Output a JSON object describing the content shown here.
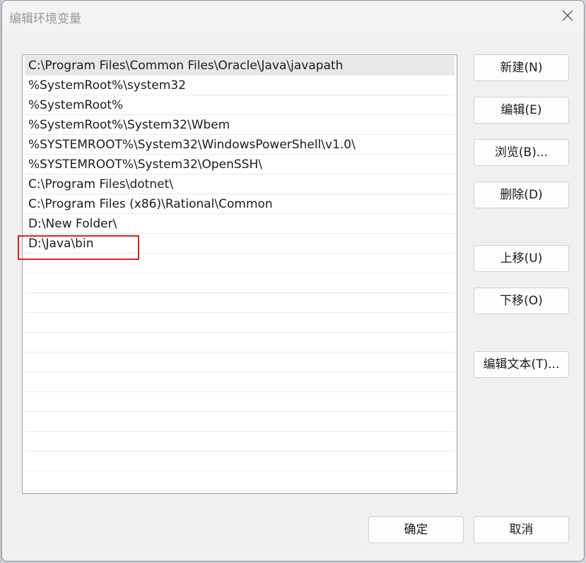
{
  "window": {
    "title": "编辑环境变量"
  },
  "path_list": {
    "items": [
      "C:\\Program Files\\Common Files\\Oracle\\Java\\javapath",
      "%SystemRoot%\\system32",
      "%SystemRoot%",
      "%SystemRoot%\\System32\\Wbem",
      "%SYSTEMROOT%\\System32\\WindowsPowerShell\\v1.0\\",
      "%SYSTEMROOT%\\System32\\OpenSSH\\",
      "C:\\Program Files\\dotnet\\",
      "C:\\Program Files (x86)\\Rational\\Common",
      "D:\\New Folder\\",
      "D:\\Java\\bin"
    ],
    "selected_index": 0,
    "highlighted_index": 9
  },
  "buttons": {
    "new": "新建(N)",
    "edit": "编辑(E)",
    "browse": "浏览(B)...",
    "delete": "删除(D)",
    "move_up": "上移(U)",
    "move_down": "下移(O)",
    "edit_text": "编辑文本(T)...",
    "ok": "确定",
    "cancel": "取消"
  },
  "colors": {
    "highlight_border": "#e02020",
    "selected_row": "#e8e8e8"
  },
  "icons": {
    "close": "close-icon"
  }
}
